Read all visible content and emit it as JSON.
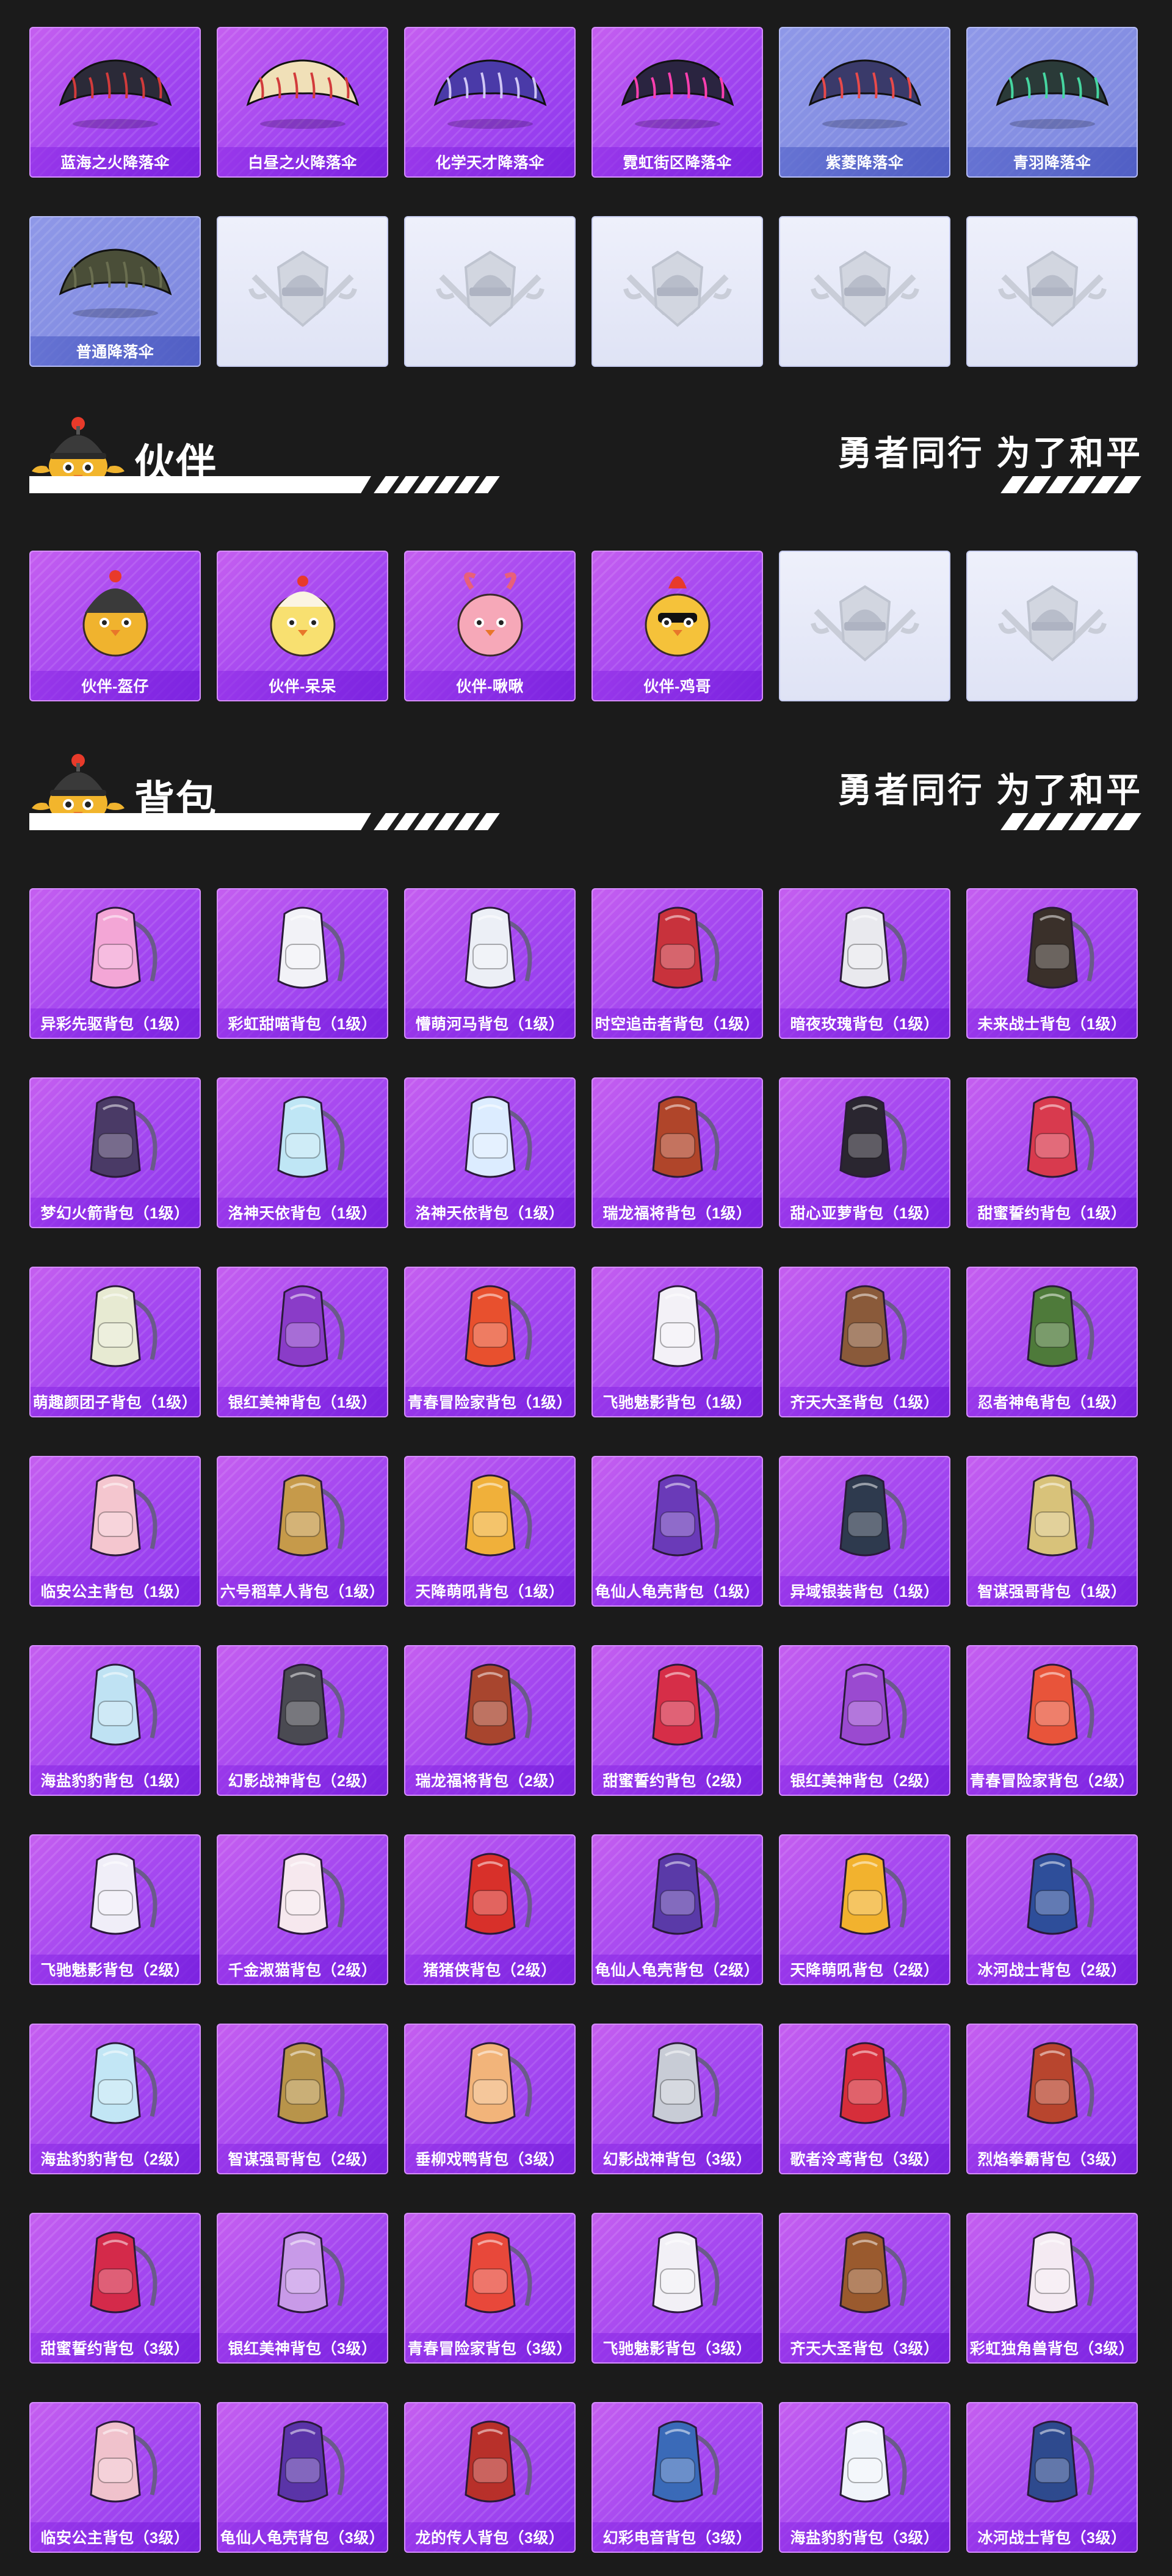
{
  "colors": {
    "background": "#1b1b1b",
    "card_pink": "#a84af0",
    "card_blue": "#7b86de",
    "card_empty": "#e6e9f7"
  },
  "parachutes": {
    "items": [
      {
        "label": "蓝海之火降落伞",
        "style": "pink",
        "icon": "parachute-dark-red-icon"
      },
      {
        "label": "白昼之火降落伞",
        "style": "pink",
        "icon": "parachute-cream-red-icon"
      },
      {
        "label": "化学天才降落伞",
        "style": "pink",
        "icon": "parachute-purple-pattern-icon"
      },
      {
        "label": "霓虹街区降落伞",
        "style": "pink",
        "icon": "parachute-neon-icon"
      },
      {
        "label": "紫菱降落伞",
        "style": "blue",
        "icon": "parachute-plaid-icon"
      },
      {
        "label": "青羽降落伞",
        "style": "blue",
        "icon": "parachute-green-feather-icon"
      },
      {
        "label": "普通降落伞",
        "style": "blue",
        "icon": "parachute-olive-icon"
      },
      {
        "label": "",
        "style": "empty",
        "icon": "pubg-emblem-placeholder-icon"
      },
      {
        "label": "",
        "style": "empty",
        "icon": "pubg-emblem-placeholder-icon"
      },
      {
        "label": "",
        "style": "empty",
        "icon": "pubg-emblem-placeholder-icon"
      },
      {
        "label": "",
        "style": "empty",
        "icon": "pubg-emblem-placeholder-icon"
      },
      {
        "label": "",
        "style": "empty",
        "icon": "pubg-emblem-placeholder-icon"
      }
    ]
  },
  "companion": {
    "title": "伙伴",
    "slogan": "勇者同行 为了和平",
    "mascot_icon": "helmet-chick-mascot-icon",
    "items": [
      {
        "label": "伙伴-盔仔",
        "style": "pink",
        "icon": "companion-helmet-chick-icon"
      },
      {
        "label": "伙伴-呆呆",
        "style": "pink",
        "icon": "companion-yellow-chick-icon"
      },
      {
        "label": "伙伴-啾啾",
        "style": "pink",
        "icon": "companion-pink-bird-icon"
      },
      {
        "label": "伙伴-鸡哥",
        "style": "pink",
        "icon": "companion-rooster-icon"
      },
      {
        "label": "",
        "style": "empty",
        "icon": "pubg-emblem-placeholder-icon"
      },
      {
        "label": "",
        "style": "empty",
        "icon": "pubg-emblem-placeholder-icon"
      }
    ]
  },
  "backpacks": {
    "title": "背包",
    "slogan": "勇者同行 为了和平",
    "mascot_icon": "helmet-chick-mascot-icon",
    "items": [
      {
        "label": "异彩先驱背包（1级）",
        "color": "#f3a6d6"
      },
      {
        "label": "彩虹甜喵背包（1级）",
        "color": "#f2f2f7"
      },
      {
        "label": "懵萌河马背包（1级）",
        "color": "#eceff6"
      },
      {
        "label": "时空追击者背包（1级）",
        "color": "#c8323c"
      },
      {
        "label": "暗夜玫瑰背包（1级）",
        "color": "#e9e9ee"
      },
      {
        "label": "未来战士背包（1级）",
        "color": "#3a302a"
      },
      {
        "label": "梦幻火箭背包（1级）",
        "color": "#4a3a66"
      },
      {
        "label": "洛神天依背包（1级）",
        "color": "#bfe6f5"
      },
      {
        "label": "洛神天依背包（1级）",
        "color": "#dcecff"
      },
      {
        "label": "瑞龙福将背包（1级）",
        "color": "#b0452a"
      },
      {
        "label": "甜心亚萝背包（1级）",
        "color": "#2a2630"
      },
      {
        "label": "甜蜜誓约背包（1级）",
        "color": "#d83a4e"
      },
      {
        "label": "萌趣颜团子背包（1级）",
        "color": "#e7ead2"
      },
      {
        "label": "银红美神背包（1级）",
        "color": "#8a3cc8"
      },
      {
        "label": "青春冒险家背包（1级）",
        "color": "#e8502e"
      },
      {
        "label": "飞驰魅影背包（1级）",
        "color": "#f3f1f7"
      },
      {
        "label": "齐天大圣背包（1级）",
        "color": "#8a5a3a"
      },
      {
        "label": "忍者神龟背包（1级）",
        "color": "#4e7a3a"
      },
      {
        "label": "临安公主背包（1级）",
        "color": "#f4c6cf"
      },
      {
        "label": "六号稻草人背包（1级）",
        "color": "#c69a4a"
      },
      {
        "label": "天降萌吼背包（1级）",
        "color": "#f0b03a"
      },
      {
        "label": "龟仙人龟壳背包（1级）",
        "color": "#6a3ab8"
      },
      {
        "label": "异域银装背包（1级）",
        "color": "#2e3a4e"
      },
      {
        "label": "智谋强哥背包（1级）",
        "color": "#d8c27a"
      },
      {
        "label": "海盐豹豹背包（1级）",
        "color": "#bfe2f3"
      },
      {
        "label": "幻影战神背包（2级）",
        "color": "#4a4a52"
      },
      {
        "label": "瑞龙福将背包（2级）",
        "color": "#a8452e"
      },
      {
        "label": "甜蜜誓约背包（2级）",
        "color": "#d62e48"
      },
      {
        "label": "银红美神背包（2级）",
        "color": "#9a4ad0"
      },
      {
        "label": "青春冒险家背包（2级）",
        "color": "#e8543a"
      },
      {
        "label": "飞驰魅影背包（2级）",
        "color": "#f0eef8"
      },
      {
        "label": "千金淑猫背包（2级）",
        "color": "#f6e8ee"
      },
      {
        "label": "猪猪侠背包（2级）",
        "color": "#d8302a"
      },
      {
        "label": "龟仙人龟壳背包（2级）",
        "color": "#5a3aa8"
      },
      {
        "label": "天降萌吼背包（2级）",
        "color": "#f2b22e"
      },
      {
        "label": "冰河战士背包（2级）",
        "color": "#2e4e9a"
      },
      {
        "label": "海盐豹豹背包（2级）",
        "color": "#c2e6f5"
      },
      {
        "label": "智谋强哥背包（2级）",
        "color": "#b8944a"
      },
      {
        "label": "垂柳戏鸭背包（3级）",
        "color": "#f2b47a"
      },
      {
        "label": "幻影战神背包（3级）",
        "color": "#c8ccd6"
      },
      {
        "label": "歌者泠鸢背包（3级）",
        "color": "#d62e3a"
      },
      {
        "label": "烈焰拳霸背包（3级）",
        "color": "#b8452e"
      },
      {
        "label": "甜蜜誓约背包（3级）",
        "color": "#d42a4a"
      },
      {
        "label": "银红美神背包（3级）",
        "color": "#c89ae8"
      },
      {
        "label": "青春冒险家背包（3级）",
        "color": "#e8483a"
      },
      {
        "label": "飞驰魅影背包（3级）",
        "color": "#f2f0f6"
      },
      {
        "label": "齐天大圣背包（3级）",
        "color": "#9a5a2e"
      },
      {
        "label": "彩虹独角兽背包（3级）",
        "color": "#f4eaf2"
      },
      {
        "label": "临安公主背包（3级）",
        "color": "#f0c2cc"
      },
      {
        "label": "龟仙人龟壳背包（3级）",
        "color": "#5a34a8"
      },
      {
        "label": "龙的传人背包（3级）",
        "color": "#b8302a"
      },
      {
        "label": "幻彩电音背包（3级）",
        "color": "#3a6ab8"
      },
      {
        "label": "海盐豹豹背包（3级）",
        "color": "#f0f4fa"
      },
      {
        "label": "冰河战士背包（3级）",
        "color": "#2e4a8e"
      }
    ]
  }
}
